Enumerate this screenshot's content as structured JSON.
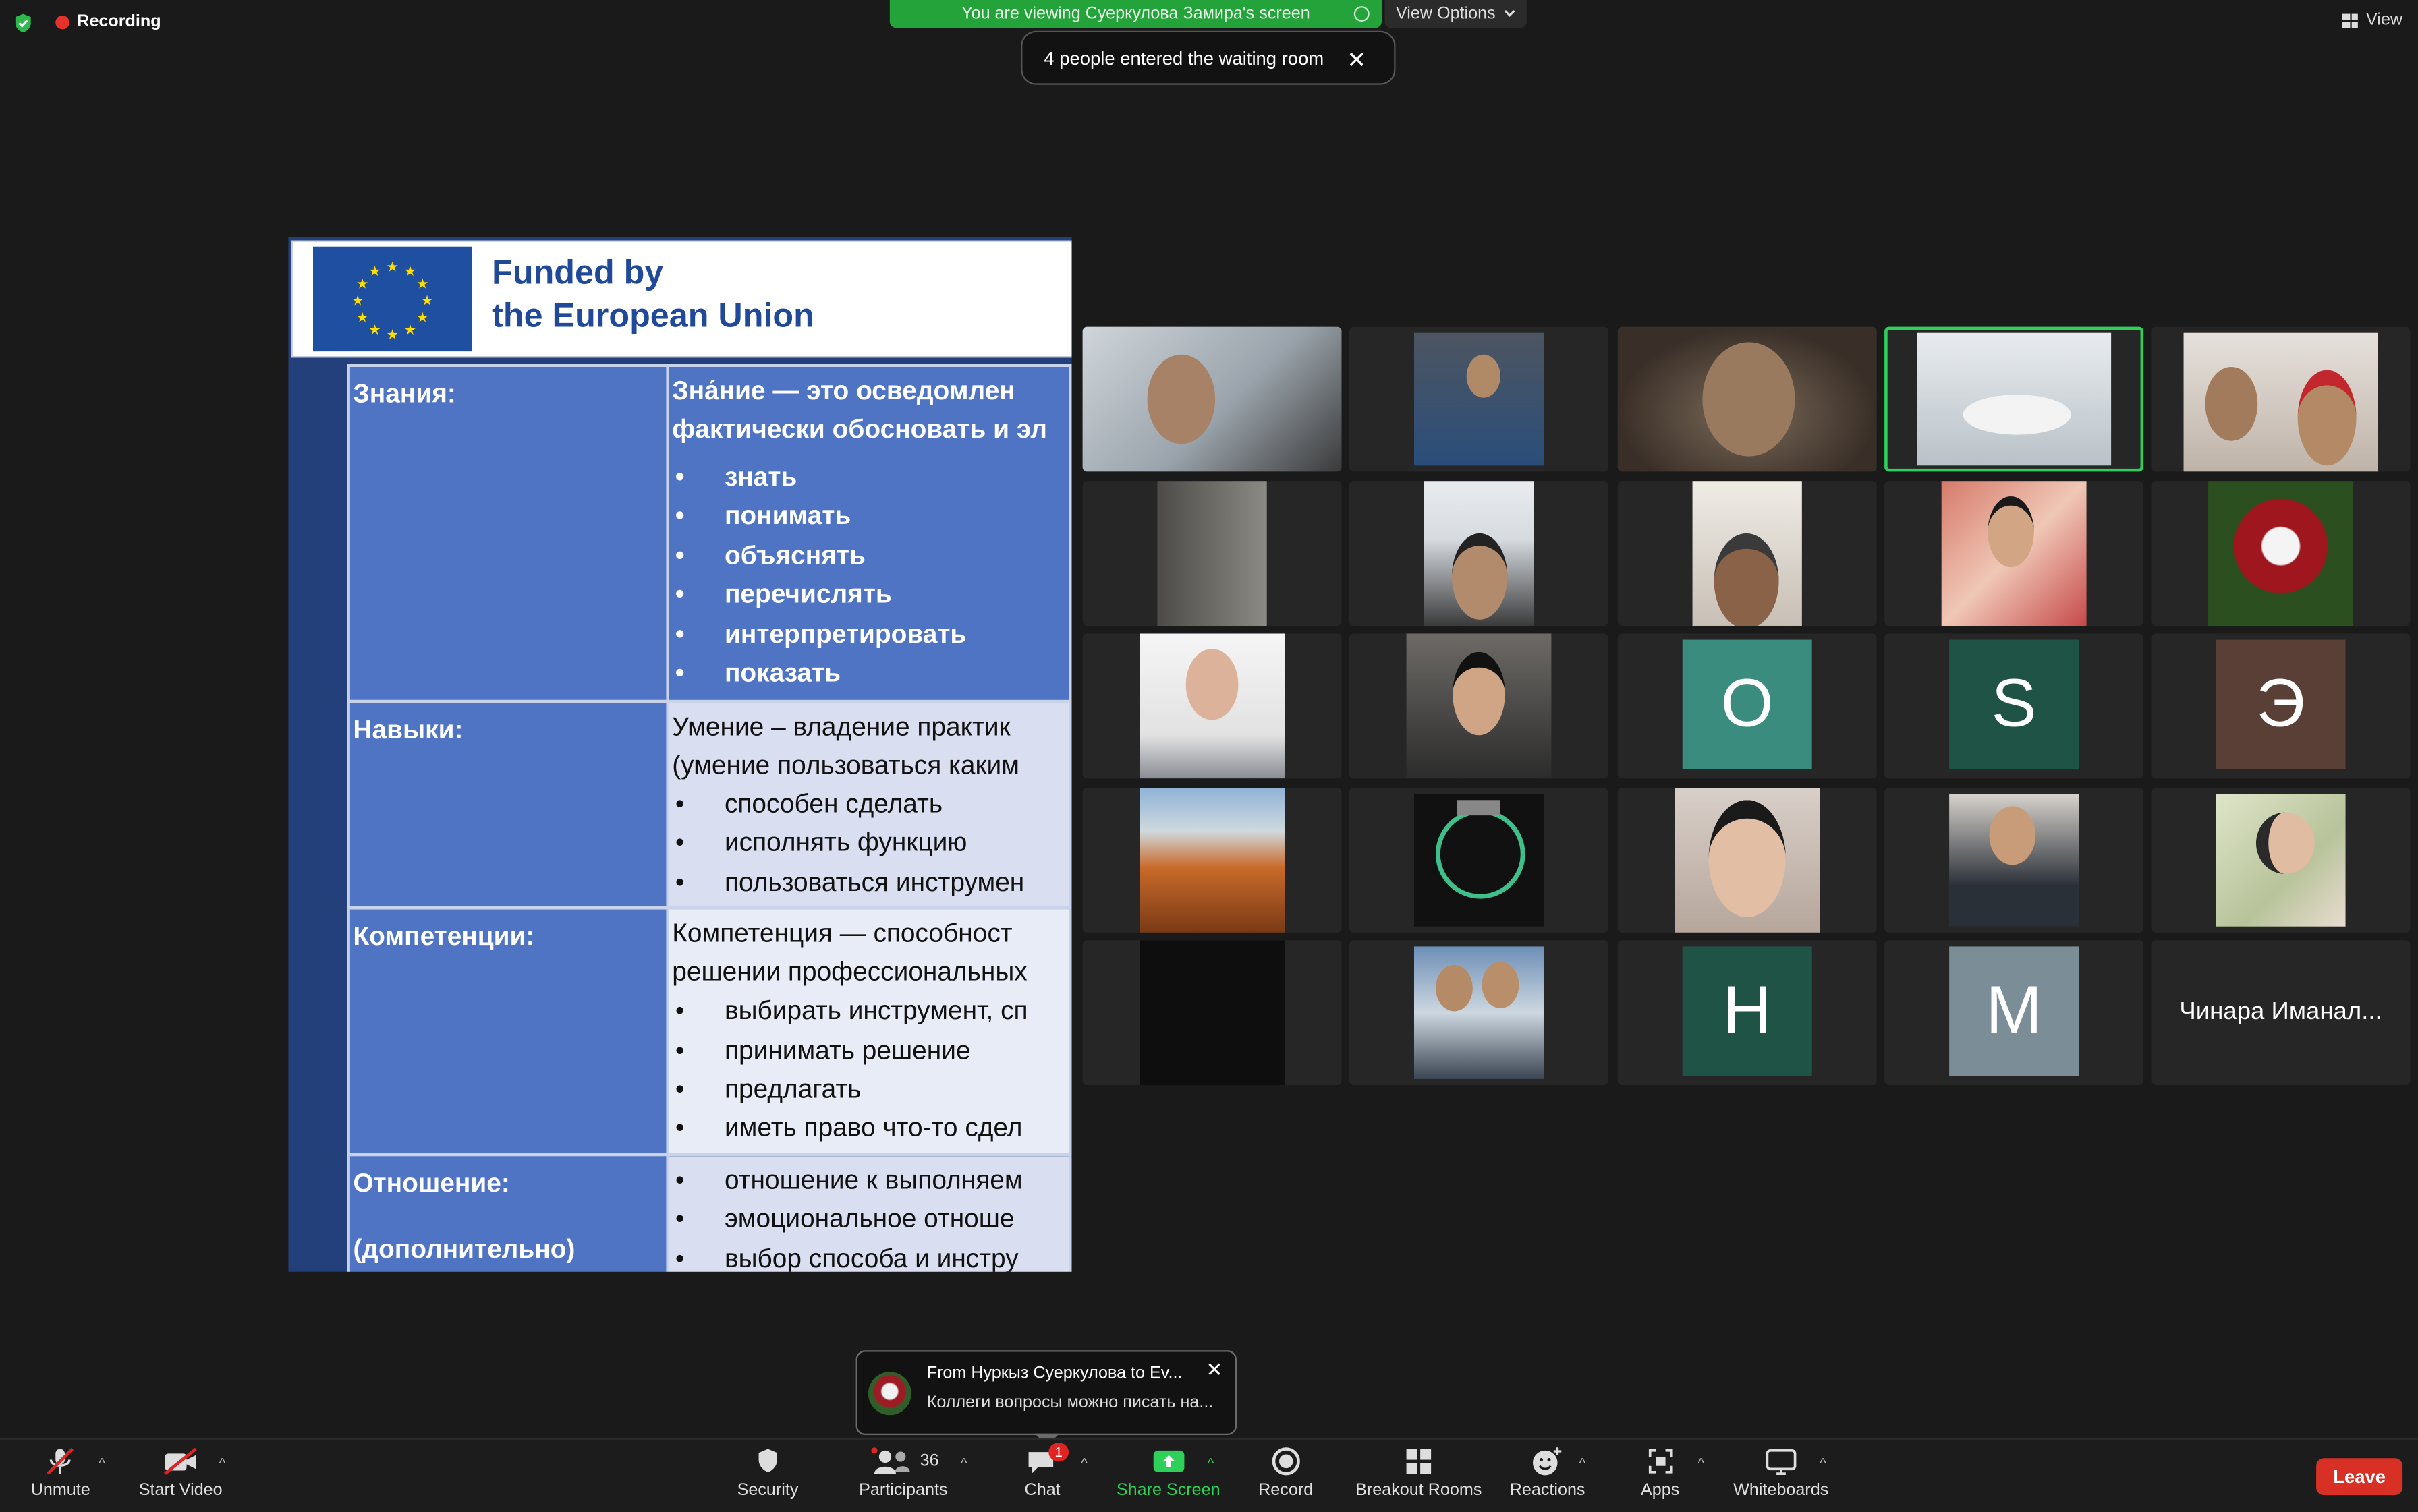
{
  "top": {
    "recording_label": "Recording",
    "viewing_banner": "You are viewing Суеркулова Замира's screen",
    "view_options": "View Options",
    "waiting_toast": "4 people entered the waiting room",
    "view_label": "View"
  },
  "slide": {
    "header": [
      "Funded by",
      "the European Union"
    ],
    "rows": [
      {
        "label": "Знания:",
        "def_lines": [
          "Зна́ние — это осведомлен",
          "фактически обосновать и эл"
        ],
        "bullets": [
          "знать",
          "понимать",
          "объяснять",
          "перечислять",
          "интерпретировать",
          "показать"
        ]
      },
      {
        "label": "Навыки:",
        "def_lines": [
          "Умение – владение практик",
          "(умение пользоваться каким"
        ],
        "bullets": [
          "способен сделать",
          "исполнять функцию",
          "пользоваться инструмен"
        ]
      },
      {
        "label": "Компетенции:",
        "def_lines": [
          "Компетенция — способност",
          "решении профессиональных"
        ],
        "bullets": [
          "выбирать инструмент, сп",
          "принимать решение",
          "предлагать",
          "иметь право что-то сдел"
        ]
      },
      {
        "label": "Отношение:",
        "label2": "(дополнительно)",
        "def_lines": [],
        "bullets": [
          "отношение к выполняем",
          "эмоциональное отноше",
          "выбор способа и инстру"
        ]
      }
    ]
  },
  "gallery": {
    "initials": [
      "O",
      "S",
      "Э",
      "H",
      "M"
    ],
    "initial_colors": [
      "#3a8c7f",
      "#1f5346",
      "#5a3f36",
      "#1f5346",
      "#7b8d96"
    ],
    "name_only": "Чинара Иманал..."
  },
  "chat_popup": {
    "from": "From Нуркыз Суеркулова to Ev...",
    "message": "Коллеги вопросы можно писать на..."
  },
  "toolbar": {
    "unmute": "Unmute",
    "start_video": "Start Video",
    "security": "Security",
    "participants": "Participants",
    "participants_count": "36",
    "chat": "Chat",
    "chat_badge": "1",
    "share_screen": "Share Screen",
    "record": "Record",
    "breakout": "Breakout Rooms",
    "reactions": "Reactions",
    "apps": "Apps",
    "whiteboards": "Whiteboards",
    "leave": "Leave"
  }
}
